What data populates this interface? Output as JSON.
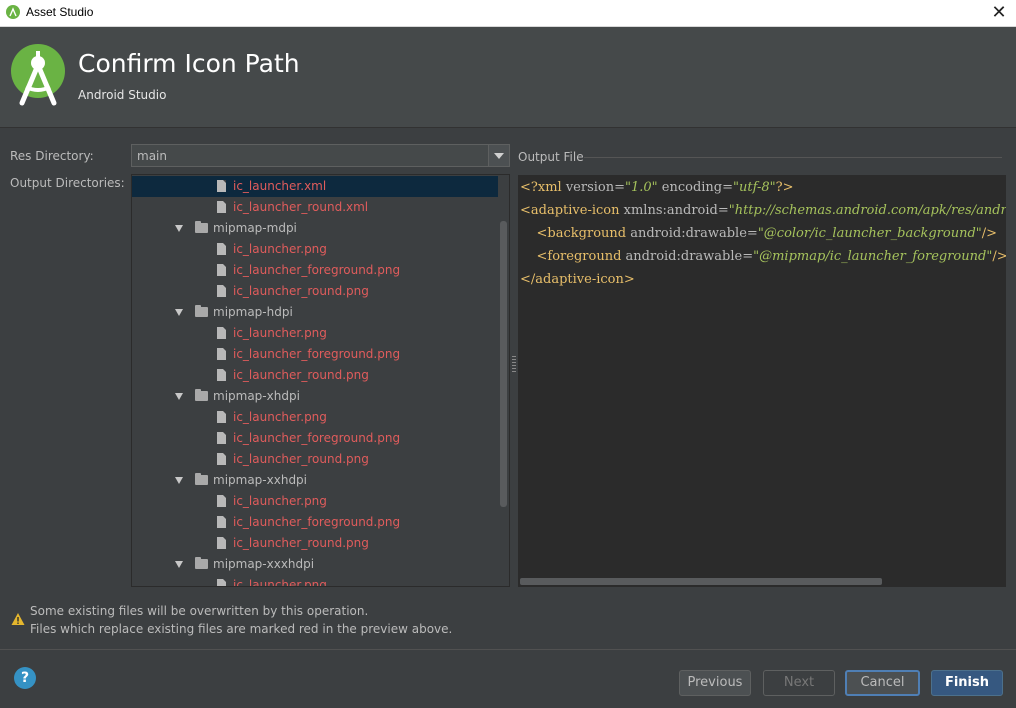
{
  "window": {
    "title": "Asset Studio"
  },
  "header": {
    "title": "Confirm Icon Path",
    "subtitle": "Android Studio"
  },
  "form": {
    "res_directory_label": "Res Directory:",
    "res_directory_value": "main",
    "output_directories_label": "Output Directories:"
  },
  "tree": [
    {
      "kind": "file",
      "name": "ic_launcher.xml",
      "selected": true
    },
    {
      "kind": "file",
      "name": "ic_launcher_round.xml"
    },
    {
      "kind": "folder",
      "name": "mipmap-mdpi"
    },
    {
      "kind": "file",
      "name": "ic_launcher.png"
    },
    {
      "kind": "file",
      "name": "ic_launcher_foreground.png"
    },
    {
      "kind": "file",
      "name": "ic_launcher_round.png"
    },
    {
      "kind": "folder",
      "name": "mipmap-hdpi"
    },
    {
      "kind": "file",
      "name": "ic_launcher.png"
    },
    {
      "kind": "file",
      "name": "ic_launcher_foreground.png"
    },
    {
      "kind": "file",
      "name": "ic_launcher_round.png"
    },
    {
      "kind": "folder",
      "name": "mipmap-xhdpi"
    },
    {
      "kind": "file",
      "name": "ic_launcher.png"
    },
    {
      "kind": "file",
      "name": "ic_launcher_foreground.png"
    },
    {
      "kind": "file",
      "name": "ic_launcher_round.png"
    },
    {
      "kind": "folder",
      "name": "mipmap-xxhdpi"
    },
    {
      "kind": "file",
      "name": "ic_launcher.png"
    },
    {
      "kind": "file",
      "name": "ic_launcher_foreground.png"
    },
    {
      "kind": "file",
      "name": "ic_launcher_round.png"
    },
    {
      "kind": "folder",
      "name": "mipmap-xxxhdpi"
    },
    {
      "kind": "file",
      "name": "ic_launcher.png"
    }
  ],
  "output_file": {
    "label": "Output File",
    "code": {
      "line1": {
        "open": "<?xml",
        "a1": " version=",
        "v1": "\"1.0\"",
        "a2": " encoding=",
        "v2": "\"utf-8\"",
        "close": "?>"
      },
      "line2": {
        "open": "<adaptive-icon",
        "a1": " xmlns:android=",
        "v1": "\"http://schemas.android.com/apk/res/android\"",
        "close": ">"
      },
      "line3": {
        "indent": "    ",
        "open": "<background",
        "a1": " android:drawable=",
        "v1": "\"@color/ic_launcher_background\"",
        "close": "/>"
      },
      "line4": {
        "indent": "    ",
        "open": "<foreground",
        "a1": " android:drawable=",
        "v1": "\"@mipmap/ic_launcher_foreground\"",
        "close": "/>"
      },
      "line5": {
        "close": "</adaptive-icon>"
      }
    }
  },
  "warning": {
    "line1": "Some existing files will be overwritten by this operation.",
    "line2": "Files which replace existing files are marked red in the preview above."
  },
  "buttons": {
    "help": "?",
    "previous": "Previous",
    "next": "Next",
    "cancel": "Cancel",
    "finish": "Finish"
  },
  "colors": {
    "background": "#3c3f41",
    "overwrite_red": "#e05c5c",
    "xml_tag": "#e8bf6a",
    "xml_string": "#a5c25c",
    "default_button": "#365880"
  },
  "icons": [
    "android-studio-icon",
    "close-icon",
    "dropdown-arrow-icon",
    "folder-icon",
    "file-icon",
    "expand-arrow-icon",
    "warning-icon",
    "help-icon"
  ]
}
